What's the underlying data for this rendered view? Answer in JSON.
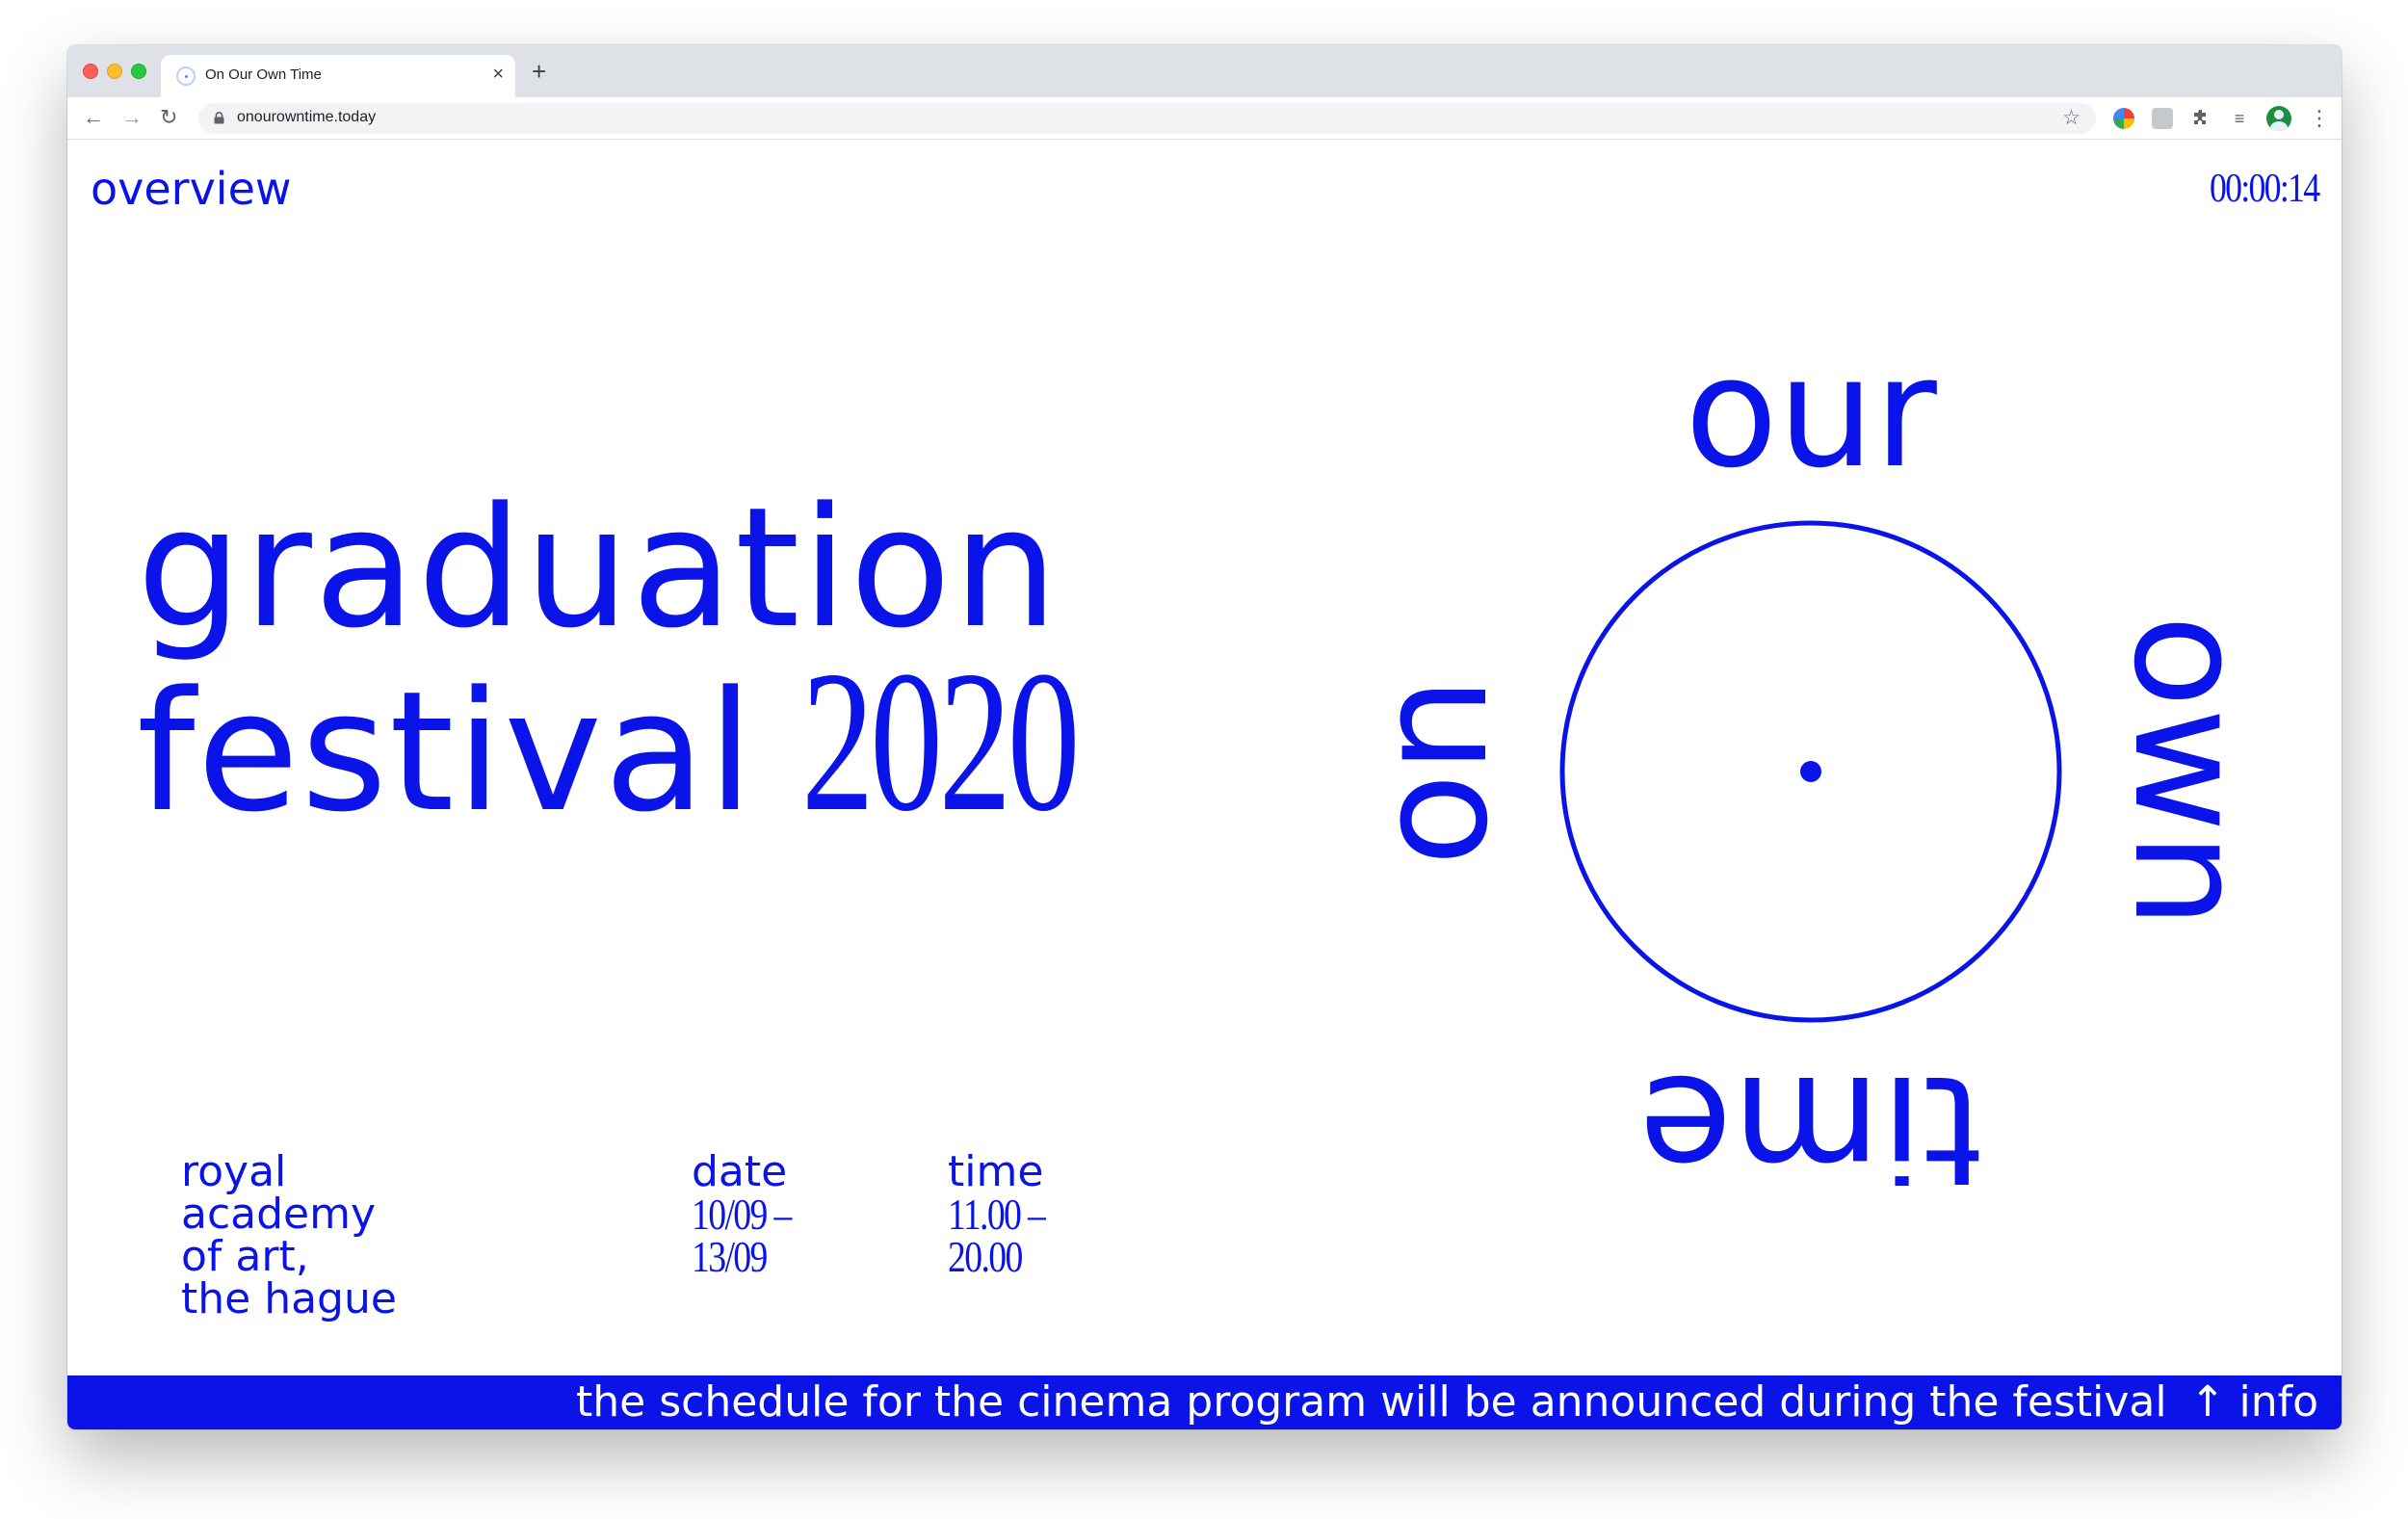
{
  "browser": {
    "tab_title": "On Our Own Time",
    "tab_close": "×",
    "new_tab": "+",
    "url": "onourowntime.today",
    "back": "←",
    "forward": "→",
    "reload": "↻",
    "star": "☆",
    "extensions_icon": "⚲",
    "queue_icon": "≡",
    "menu": "⋮"
  },
  "site": {
    "nav_overview": "overview",
    "clock": "00:00:14",
    "headline_line1": "graduation",
    "headline_festival": "festival",
    "headline_year": "2020",
    "location": [
      "royal",
      "academy",
      "of art,",
      "the hague"
    ],
    "date_label": "date",
    "date_values": [
      "10/09 –",
      "13/09"
    ],
    "time_label": "time",
    "time_values": [
      "11.00 –",
      "20.00"
    ],
    "logo_words": {
      "top": "our",
      "right": "own",
      "bottom": "time",
      "left": "on"
    },
    "ticker_message": "the schedule for the cinema program will be announced during the festival",
    "ticker_info": "↑ info"
  },
  "colors": {
    "accent_blue": "#0a14e8",
    "chrome_bg": "#dee1e6",
    "page_bg": "#ffffff"
  }
}
